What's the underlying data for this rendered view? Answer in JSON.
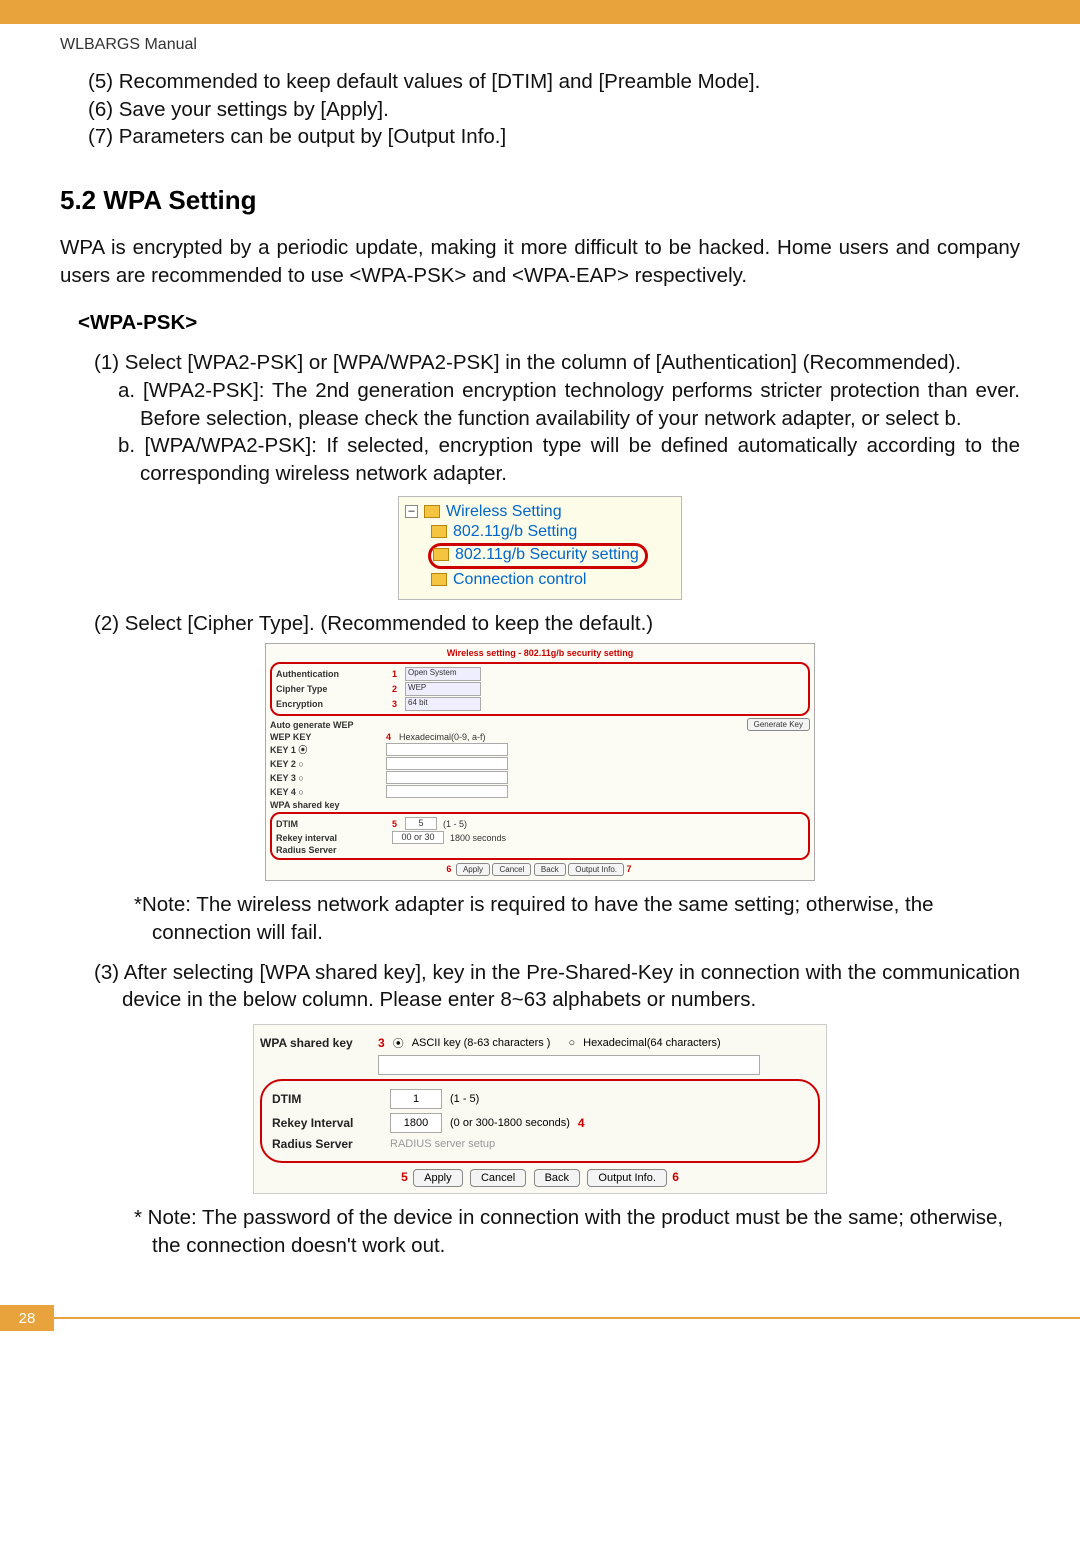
{
  "header": {
    "manual_title": "WLBARGS Manual"
  },
  "intro_list": {
    "i5": "(5) Recommended to keep default values of [DTIM] and [Preamble Mode].",
    "i6": "(6) Save your settings by [Apply].",
    "i7": "(7) Parameters can be output by [Output Info.]"
  },
  "section": {
    "heading": "5.2 WPA Setting",
    "para": "WPA is encrypted by a periodic update, making it more difficult to be hacked. Home users and company users are recommended to use <WPA-PSK> and <WPA-EAP> respectively."
  },
  "wpa_psk": {
    "heading": "<WPA-PSK>",
    "step1": "(1) Select [WPA2-PSK] or [WPA/WPA2-PSK] in the column of [Authentication] (Recommended).",
    "step1a": "a. [WPA2-PSK]: The 2nd generation encryption technology performs stricter protection than ever.  Before selection, please check the function availability of your network adapter, or select b.",
    "step1b": "b. [WPA/WPA2-PSK]: If selected, encryption type will be defined automatically according to the corresponding wireless network adapter.",
    "step2": "(2) Select [Cipher Type]. (Recommended to keep the default.)",
    "note2": "*Note: The wireless network adapter is required to have the same setting; otherwise, the connection will fail.",
    "step3": "(3) After selecting [WPA shared key], key in the Pre-Shared-Key in connection with the communication device in the below column.  Please enter 8~63 alphabets or numbers.",
    "note3": "* Note: The password of the device in connection with the product must be the same; otherwise, the connection doesn't work out."
  },
  "tree": {
    "root": "Wireless Setting",
    "n1": "802.11g/b Setting",
    "n2": "802.11g/b Security setting",
    "n3": "Connection control"
  },
  "fig2": {
    "title": "Wireless setting - 802.11g/b security setting",
    "auth_label": "Authentication",
    "auth_value": "Open System",
    "cipher_label": "Cipher Type",
    "cipher_value": "WEP",
    "enc_label": "Encryption",
    "enc_value": "64 bit",
    "autogen": "Auto generate WEP",
    "gen_btn": "Generate Key",
    "wep_key_label": "WEP KEY",
    "hex_hint": "Hexadecimal(0-9, a-f)",
    "key1": "KEY 1 ⦿",
    "key2": "KEY 2 ○",
    "key3": "KEY 3 ○",
    "key4": "KEY 4 ○",
    "wpa_shared": "WPA shared key",
    "dtim_label": "DTIM",
    "dtim_val": "5",
    "dtim_hint": "(1 - 5)",
    "rekey_label": "Rekey interval",
    "rekey_val": "00 or 30",
    "rekey_hint": "1800 seconds",
    "radius_label": "Radius Server",
    "btn_apply": "Apply",
    "btn_cancel": "Cancel",
    "btn_back": "Back",
    "btn_output": "Output Info.",
    "n1": "1",
    "n2": "2",
    "n3": "3",
    "n4": "4",
    "n5": "5",
    "n6": "6",
    "n7": "7"
  },
  "fig3": {
    "wpa_label": "WPA shared key",
    "ascii_label": "ASCII key (8-63 characters )",
    "hex_label": "Hexadecimal(64 characters)",
    "dtim_label": "DTIM",
    "dtim_val": "1",
    "dtim_hint": "(1 - 5)",
    "rekey_label": "Rekey Interval",
    "rekey_val": "1800",
    "rekey_hint": "(0 or 300-1800 seconds)",
    "radius_label": "Radius Server",
    "radius_placeholder": "RADIUS server setup",
    "btn_apply": "Apply",
    "btn_cancel": "Cancel",
    "btn_back": "Back",
    "btn_output": "Output Info.",
    "n3": "3",
    "n4": "4",
    "n5": "5",
    "n6": "6"
  },
  "footer": {
    "page_number": "28"
  }
}
